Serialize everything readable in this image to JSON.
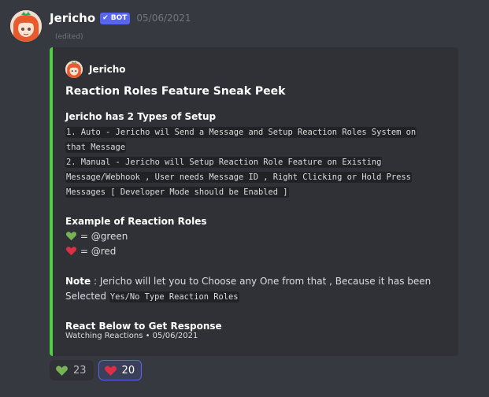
{
  "message": {
    "username": "Jericho",
    "bot_tag": "BOT",
    "timestamp": "05/06/2021",
    "edited_label": "(edited)"
  },
  "embed": {
    "accent_color": "#4bd33e",
    "author": "Jericho",
    "title": "Reaction Roles Feature Sneak Peek",
    "setup_heading": "Jericho has 2 Types of Setup",
    "auto_line_1": "1. Auto - Jericho wil Send a Message and Setup Reaction Roles System on",
    "auto_line_2": "that Message",
    "manual_line_1": "2. Manual - Jericho will Setup Reaction Role Feature on Existing",
    "manual_line_2": "Message/Webhook , User needs Message ID , Right Clicking or Hold Press",
    "manual_line_3": "Messages [ Developer Mode should be Enabled ]",
    "example_heading": "Example of Reaction Roles",
    "roles": [
      {
        "emoji": "green-heart-icon",
        "text": "= @green"
      },
      {
        "emoji": "red-heart-icon",
        "text": "= @red"
      }
    ],
    "note_label": "Note",
    "note_text": " : Jericho will let you to Choose any One from that , Because it has been",
    "note_text_2": "Selected ",
    "note_code": "Yes/No Type Reaction Roles",
    "react_heading": "React Below to Get Response",
    "footer": "Watching Reactions • 05/06/2021"
  },
  "reactions": [
    {
      "emoji": "green-heart-icon",
      "count": "23",
      "me": false
    },
    {
      "emoji": "red-heart-icon",
      "count": "20",
      "me": true
    }
  ]
}
